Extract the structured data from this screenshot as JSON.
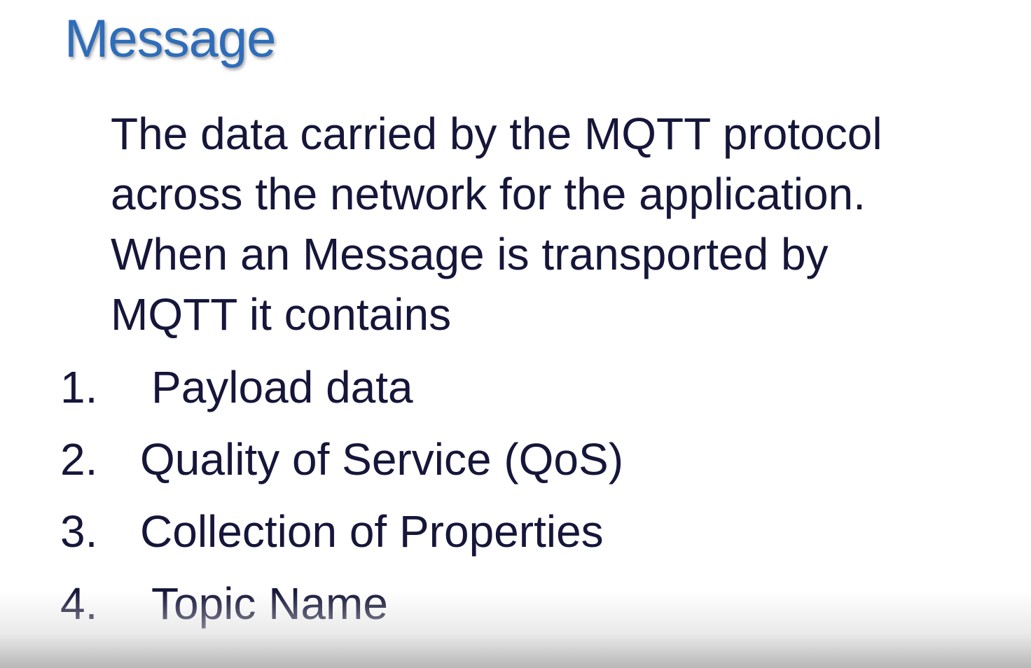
{
  "slide": {
    "title": "Message",
    "body_lines": [
      "The data carried by the MQTT protocol",
      "across the network for the application.",
      "When an  Message is transported by",
      "MQTT it contains"
    ],
    "items": [
      {
        "number": "1.",
        "label": "Payload data"
      },
      {
        "number": "2.",
        "label": "Quality of Service (QoS)"
      },
      {
        "number": "3.",
        "label": "Collection of  Properties"
      },
      {
        "number": "4.",
        "label": "Topic Name"
      }
    ]
  },
  "colors": {
    "title": "#2e6db9",
    "text": "#16163a",
    "background": "#ffffff"
  }
}
